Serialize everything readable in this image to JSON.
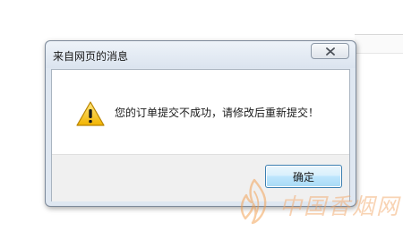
{
  "dialog": {
    "title": "来自网页的消息",
    "message": "您的订单提交不成功，请修改后重新提交！",
    "ok_label": "确定",
    "icon": "warning-icon",
    "close_icon": "close-icon"
  },
  "watermark": {
    "text": "中国香烟网",
    "logo": "flame-logo"
  }
}
